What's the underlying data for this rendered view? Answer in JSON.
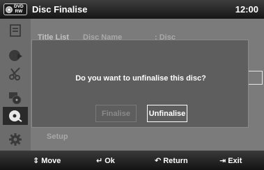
{
  "header": {
    "disc_type": "DVD\nRW",
    "title": "Disc Finalise",
    "time": "12:00"
  },
  "sidebar": {
    "items": [
      {
        "icon": "title-list-icon"
      },
      {
        "icon": "playlist-icon"
      },
      {
        "icon": "scissors-icon"
      },
      {
        "icon": "disc-manager-icon"
      },
      {
        "icon": "disc-icon",
        "active": true
      },
      {
        "icon": "gear-icon"
      }
    ]
  },
  "background": {
    "title_list": "Title List",
    "disc_name_label": "Disc Name",
    "disc_name_value": ": Disc",
    "setup": "Setup"
  },
  "dialog": {
    "message": "Do you want to unfinalise this disc?",
    "finalise_label": "Finalise",
    "unfinalise_label": "Unfinalise"
  },
  "help": {
    "move": "Move",
    "ok": "Ok",
    "return": "Return",
    "exit": "Exit"
  },
  "colors": {
    "title_bar": "#2a2a2a",
    "background": "#7b7b7b",
    "dialog": "#5e5e5e",
    "focus_border": "#ffffff"
  }
}
